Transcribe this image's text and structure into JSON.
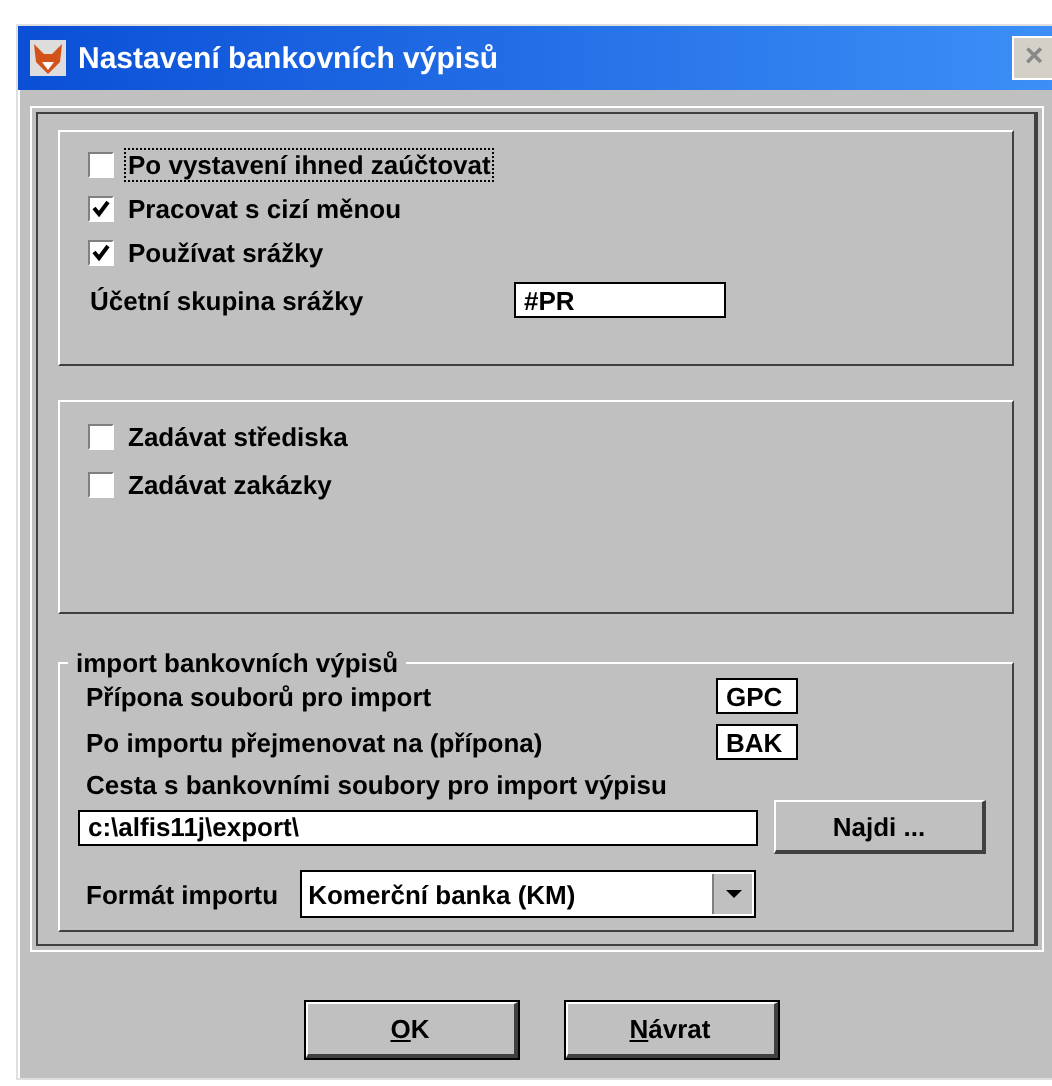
{
  "window": {
    "title": "Nastavení bankovních výpisů",
    "close": "×"
  },
  "panel_1": {
    "checkboxes": [
      {
        "label": "Po vystavení ihned zaúčtovat",
        "checked": false,
        "focused": true
      },
      {
        "label": "Pracovat s cizí měnou",
        "checked": true,
        "focused": false
      },
      {
        "label": "Používat srážky",
        "checked": true,
        "focused": false
      }
    ],
    "field": {
      "label": "Účetní skupina srážky",
      "value": "#PR"
    }
  },
  "panel_2": {
    "checkboxes": [
      {
        "label": "Zadávat střediska",
        "checked": false,
        "focused": false
      },
      {
        "label": "Zadávat zakázky",
        "checked": false,
        "focused": false
      }
    ]
  },
  "import_group": {
    "title": "import bankovních výpisů",
    "extension": {
      "label": "Přípona souborů pro import",
      "value": "GPC"
    },
    "rename": {
      "label": "Po importu přejmenovat na (přípona)",
      "value": "BAK"
    },
    "path": {
      "label": "Cesta s bankovními soubory pro import výpisu",
      "value": "c:\\alfis11j\\export\\",
      "button": "Najdi ..."
    },
    "format": {
      "label": "Formát importu",
      "value": "Komerční banka (KM)"
    }
  },
  "buttons": [
    {
      "label": "OK",
      "first_letter_underlined": true
    },
    {
      "label": "Návrat",
      "first_letter_underlined": true
    }
  ]
}
